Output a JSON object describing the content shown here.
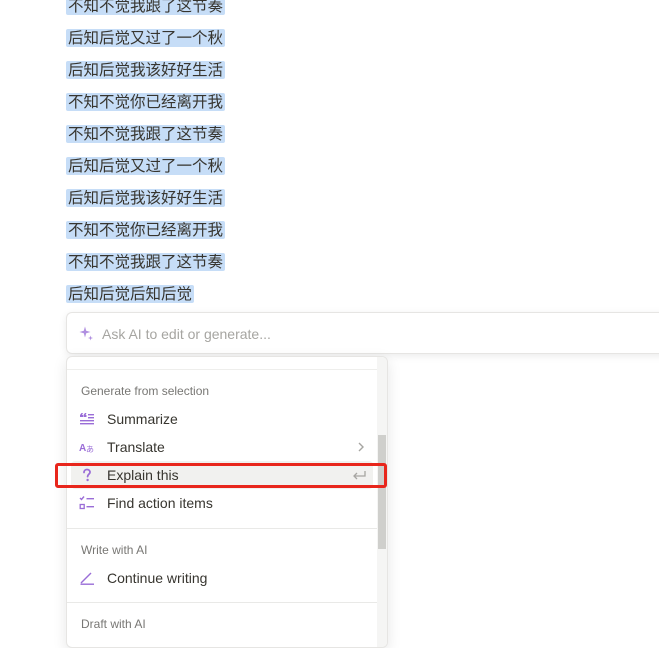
{
  "document": {
    "lines": [
      "不知不觉我跟了这节奏",
      "后知后觉又过了一个秋",
      "后知后觉我该好好生活",
      "不知不觉你已经离开我",
      "不知不觉我跟了这节奏",
      "后知后觉又过了一个秋",
      "后知后觉我该好好生活",
      "不知不觉你已经离开我",
      "不知不觉我跟了这节奏",
      "后知后觉后知后觉"
    ]
  },
  "ai_prompt": {
    "placeholder": "Ask AI to edit or generate...",
    "icon": "sparkle-icon"
  },
  "menu": {
    "sections": [
      {
        "label": "Generate from selection",
        "items": [
          {
            "label": "Summarize",
            "icon": "summarize-icon"
          },
          {
            "label": "Translate",
            "icon": "translate-icon",
            "submenu": true
          },
          {
            "label": "Explain this",
            "icon": "question-icon",
            "shortcut": "enter",
            "highlighted": true
          },
          {
            "label": "Find action items",
            "icon": "checklist-icon"
          }
        ]
      },
      {
        "label": "Write with AI",
        "items": [
          {
            "label": "Continue writing",
            "icon": "pen-icon"
          }
        ]
      },
      {
        "label": "Draft with AI",
        "items": []
      }
    ]
  },
  "colors": {
    "accent_purple": "#9a6dd7",
    "selection": "#c6ddf7",
    "highlight_box": "#e8261c"
  }
}
